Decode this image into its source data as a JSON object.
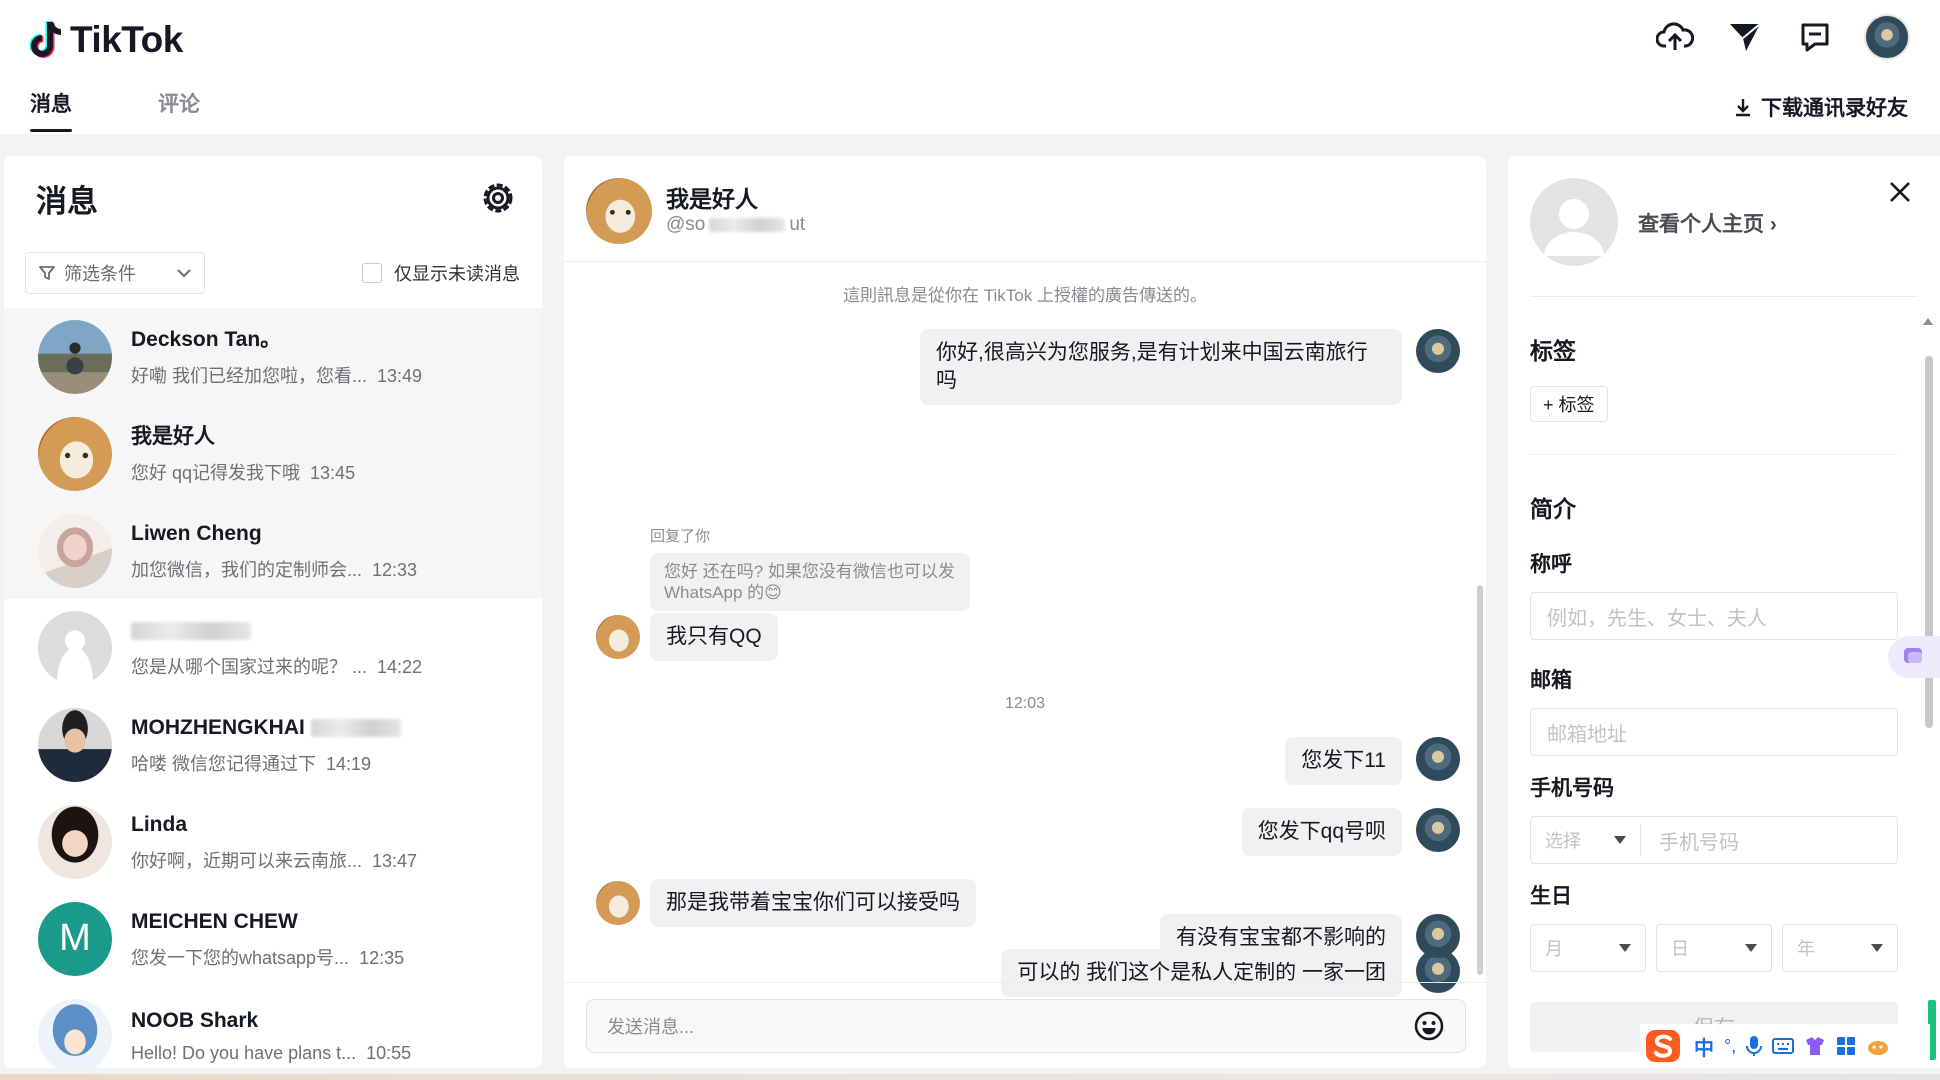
{
  "app": {
    "logo_text": "TikTok"
  },
  "tabs": [
    {
      "label": "消息",
      "active": true
    },
    {
      "label": "评论",
      "active": false
    }
  ],
  "header": {
    "download_label": "下载通讯录好友"
  },
  "messages_panel": {
    "title": "消息",
    "filter_label": "筛选条件",
    "unread_only_label": "仅显示未读消息",
    "conversations": [
      {
        "name": "Deckson Tan。",
        "preview": "好嘞 我们已经加您啦，您看...",
        "time": "13:49"
      },
      {
        "name": "我是好人",
        "preview": "您好 qq记得发我下哦",
        "time": "13:45"
      },
      {
        "name": "Liwen Cheng",
        "preview": "加您微信，我们的定制师会...",
        "time": "12:33"
      },
      {
        "name": "",
        "preview": "您是从哪个国家过来的呢？ ...",
        "time": "14:22"
      },
      {
        "name": "MOHZHENGKHAI",
        "preview": "哈喽 微信您记得通过下",
        "time": "14:19"
      },
      {
        "name": "Linda",
        "preview": "你好啊，近期可以来云南旅...",
        "time": "13:47"
      },
      {
        "name": "MEICHEN CHEW",
        "preview": "您发一下您的whatsapp号...",
        "time": "12:35",
        "initial": "M"
      },
      {
        "name": "NOOB Shark",
        "preview": "Hello! Do you have plans t...",
        "time": "10:55"
      }
    ]
  },
  "chat": {
    "name": "我是好人",
    "handle": "@so",
    "handle_suffix": "ut",
    "ad_notice": "這則訊息是從你在 TikTok 上授權的廣告傳送的。",
    "reply_label": "回复了你",
    "reply_quote": "您好 还在吗? 如果您没有微信也可以发WhatsApp 的😊",
    "time_separator": "12:03",
    "messages": [
      {
        "side": "me",
        "text": "你好,很高兴为您服务,是有计划来中国云南旅行吗"
      },
      {
        "side": "them",
        "text": "我只有QQ"
      },
      {
        "side": "me",
        "text": "您发下11"
      },
      {
        "side": "me",
        "text": "您发下qq号呗"
      },
      {
        "side": "them",
        "text": "那是我带着宝宝你们可以接受吗"
      },
      {
        "side": "me",
        "text": "可以的  我们这个是私人定制的  一家一团"
      },
      {
        "side": "me",
        "text": "有没有宝宝都不影响的"
      }
    ],
    "input_placeholder": "发送消息..."
  },
  "profile_panel": {
    "view_profile": "查看个人主页",
    "tags_title": "标签",
    "add_tag": "+ 标签",
    "bio_title": "简介",
    "salutation_label": "称呼",
    "salutation_placeholder": "例如，先生、女士、夫人",
    "email_label": "邮箱",
    "email_placeholder": "邮箱地址",
    "phone_label": "手机号码",
    "phone_select": "选择",
    "phone_placeholder": "手机号码",
    "birthday_label": "生日",
    "birthday_month": "月",
    "birthday_day": "日",
    "birthday_year": "年",
    "save_label": "保存"
  },
  "ime": {
    "mode": "中"
  },
  "colors": {
    "text": "#161823",
    "muted": "#8a8b91",
    "bubble": "#f1f1f2",
    "panel_bg": "#f3f3f4",
    "accent_green": "#19c37d",
    "meichen_avatar": "#1a9a8a"
  }
}
